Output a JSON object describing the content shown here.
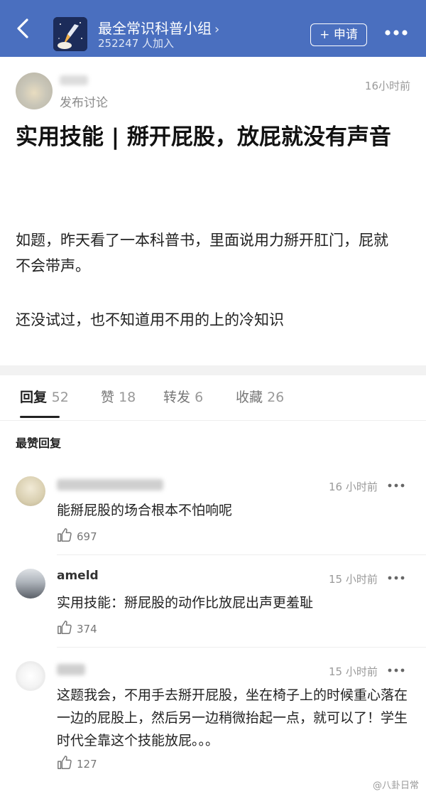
{
  "header": {
    "group_name": "最全常识科普小组",
    "group_chevron": "›",
    "member_count": "252247 人加入",
    "apply_label": "+ 申请",
    "bg_color": "#4a6fbf"
  },
  "post": {
    "author_action": "发布讨论",
    "time": "16小时前",
    "title": "实用技能 | 掰开屁股，放屁就没有声音",
    "body_lines": [
      "如题，昨天看了一本科普书，里面说用力掰开肛门，屁就不会带声。",
      "还没试过，也不知道用不用的上的冷知识"
    ]
  },
  "tabs": [
    {
      "label": "回复",
      "count": "52"
    },
    {
      "label": "赞",
      "count": "18"
    },
    {
      "label": "转发",
      "count": "6"
    },
    {
      "label": "收藏",
      "count": "26"
    }
  ],
  "section_title": "最赞回复",
  "comments": [
    {
      "name": "",
      "time": "16 小时前",
      "text": "能掰屁股的场合根本不怕响呢",
      "likes": "697"
    },
    {
      "name": "ameld",
      "time": "15 小时前",
      "text": "实用技能：掰屁股的动作比放屁出声更羞耻",
      "likes": "374"
    },
    {
      "name": "",
      "time": "15 小时前",
      "text": "这题我会，不用手去掰开屁股，坐在椅子上的时候重心落在一边的屁股上，然后另一边稍微抬起一点，就可以了！学生时代全靠这个技能放屁。。。",
      "likes": "127"
    }
  ],
  "watermark": "@八卦日常"
}
